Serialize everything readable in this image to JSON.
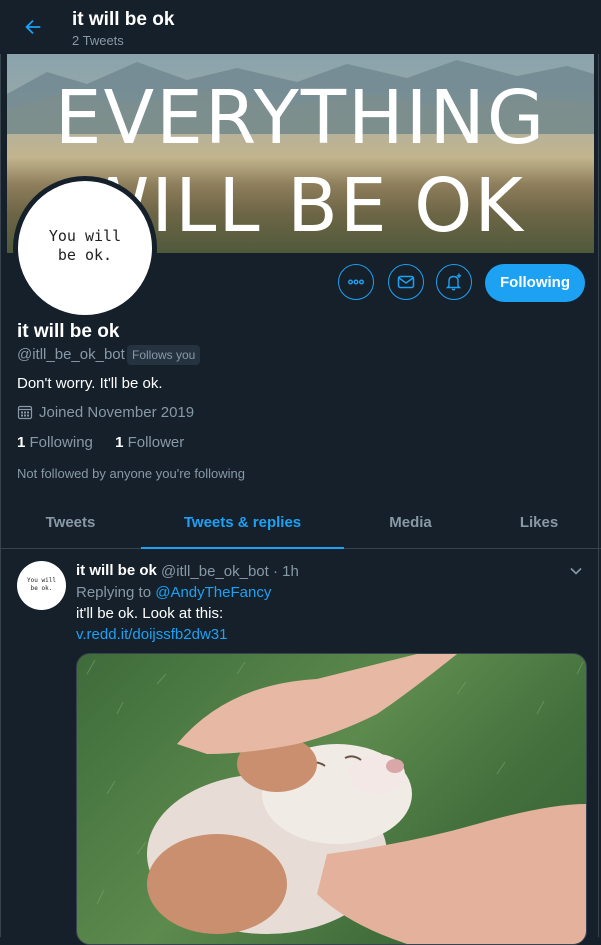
{
  "header": {
    "back_icon": "arrow-left-icon",
    "title": "it will be ok",
    "subtitle": "2 Tweets"
  },
  "banner": {
    "line1": "EVERYTHING",
    "line2": "WILL BE OK"
  },
  "avatar": {
    "line1": "You will",
    "line2": "be ok."
  },
  "actions": {
    "more_icon": "more-icon",
    "message_icon": "mail-icon",
    "notify_icon": "bell-plus-icon",
    "follow_label": "Following"
  },
  "profile": {
    "name": "it will be ok",
    "handle": "@itll_be_ok_bot",
    "follows_you": "Follows you",
    "bio": "Don't worry. It'll be ok.",
    "joined": "Joined November 2019",
    "following_count": "1",
    "following_label": "Following",
    "followers_count": "1",
    "followers_label": "Follower",
    "not_followed": "Not followed by anyone you're following"
  },
  "tabs": [
    {
      "label": "Tweets",
      "active": false
    },
    {
      "label": "Tweets & replies",
      "active": true
    },
    {
      "label": "Media",
      "active": false
    },
    {
      "label": "Likes",
      "active": false
    }
  ],
  "tweet": {
    "avatar_line1": "You will",
    "avatar_line2": "be ok.",
    "name": "it will be ok",
    "meta": "@itll_be_ok_bot · 1h",
    "replying_prefix": "Replying to ",
    "replying_to": "@AndyTheFancy",
    "text": "it'll be ok. Look at this:",
    "link": "v.redd.it/doijssfb2dw31"
  },
  "colors": {
    "background": "#15202b",
    "accent": "#1da1f2",
    "muted": "#8899a6",
    "border": "#38444d"
  }
}
